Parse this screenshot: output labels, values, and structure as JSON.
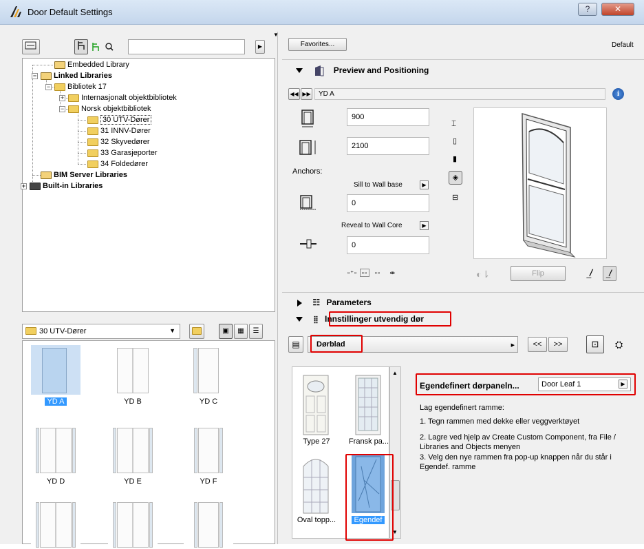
{
  "window": {
    "title": "Door Default Settings",
    "help_label": "?",
    "close_label": "✕"
  },
  "library_panel": {
    "search_placeholder": "",
    "tree": [
      {
        "label": "Embedded Library",
        "bold": false
      },
      {
        "label": "Linked Libraries",
        "bold": true
      },
      {
        "label": "Bibliotek 17",
        "bold": false
      },
      {
        "label": "Internasjonalt objektbibliotek",
        "bold": false
      },
      {
        "label": "Norsk objektbibliotek",
        "bold": false
      },
      {
        "label": "30 UTV-Dører",
        "bold": false,
        "selected": true
      },
      {
        "label": "31 INNV-Dører",
        "bold": false
      },
      {
        "label": "32 Skyvedører",
        "bold": false
      },
      {
        "label": "33 Garasjeporter",
        "bold": false
      },
      {
        "label": "34 Foldedører",
        "bold": false
      },
      {
        "label": "BIM Server Libraries",
        "bold": true
      },
      {
        "label": "Built-in Libraries",
        "bold": true
      }
    ],
    "folder_select": "30 UTV-Dører",
    "objects": [
      {
        "label": "YD A",
        "selected": true
      },
      {
        "label": "YD B"
      },
      {
        "label": "YD C"
      },
      {
        "label": "YD D"
      },
      {
        "label": "YD E"
      },
      {
        "label": "YD F"
      },
      {
        "label": ""
      },
      {
        "label": ""
      },
      {
        "label": ""
      }
    ]
  },
  "right_panel": {
    "favorites_label": "Favorites...",
    "default_label": "Default",
    "preview_section": "Preview and Positioning",
    "object_name": "YD A",
    "width_value": "900",
    "height_value": "2100",
    "anchors_label": "Anchors:",
    "sill_label": "Sill to Wall base",
    "sill_value": "0",
    "reveal_label": "Reveal to Wall Core",
    "reveal_value": "0",
    "flip_label": "Flip",
    "parameters_section": "Parameters",
    "settings_section": "Innstillinger utvendig dør",
    "page_select": "Dørblad",
    "prev_label": "<<",
    "next_label": ">>",
    "panel_type_label": "Egendefinert dørpaneln...",
    "panel_type_value": "Door Leaf 1",
    "instructions": [
      "Lag egendefinert ramme:",
      "1. Tegn rammen med dekke eller veggverktøyet",
      "2. Lagre ved hjelp av Create Custom Component, fra File / Libraries and Objects menyen",
      "3. Velg den nye rammen fra pop-up knappen når du står i Egendef. ramme"
    ],
    "door_types": [
      {
        "label": "Type 27"
      },
      {
        "label": "Fransk pa..."
      },
      {
        "label": "Oval topp..."
      },
      {
        "label": "Egendef",
        "selected": true
      }
    ]
  },
  "colors": {
    "highlight": "#3399ff",
    "annotation_red": "#e00000",
    "titlebar": "#c4d6ec"
  }
}
